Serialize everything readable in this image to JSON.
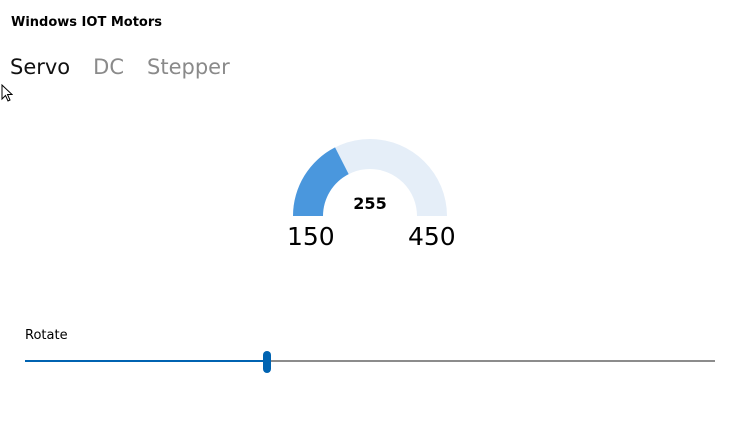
{
  "app": {
    "title": "Windows IOT Motors"
  },
  "tabs": [
    {
      "label": "Servo",
      "active": true
    },
    {
      "label": "DC",
      "active": false
    },
    {
      "label": "Stepper",
      "active": false
    }
  ],
  "gauge": {
    "value": "255",
    "min": "150",
    "max": "450",
    "value_number": 255,
    "min_number": 150,
    "max_number": 450,
    "fill_color": "#4a97dd",
    "track_color": "#e5eef8"
  },
  "slider": {
    "label": "Rotate",
    "fraction": 0.35,
    "accent_color": "#0063b1",
    "track_color": "#8c8c8c"
  },
  "icons": {
    "cursor": "mouse-pointer-icon"
  }
}
